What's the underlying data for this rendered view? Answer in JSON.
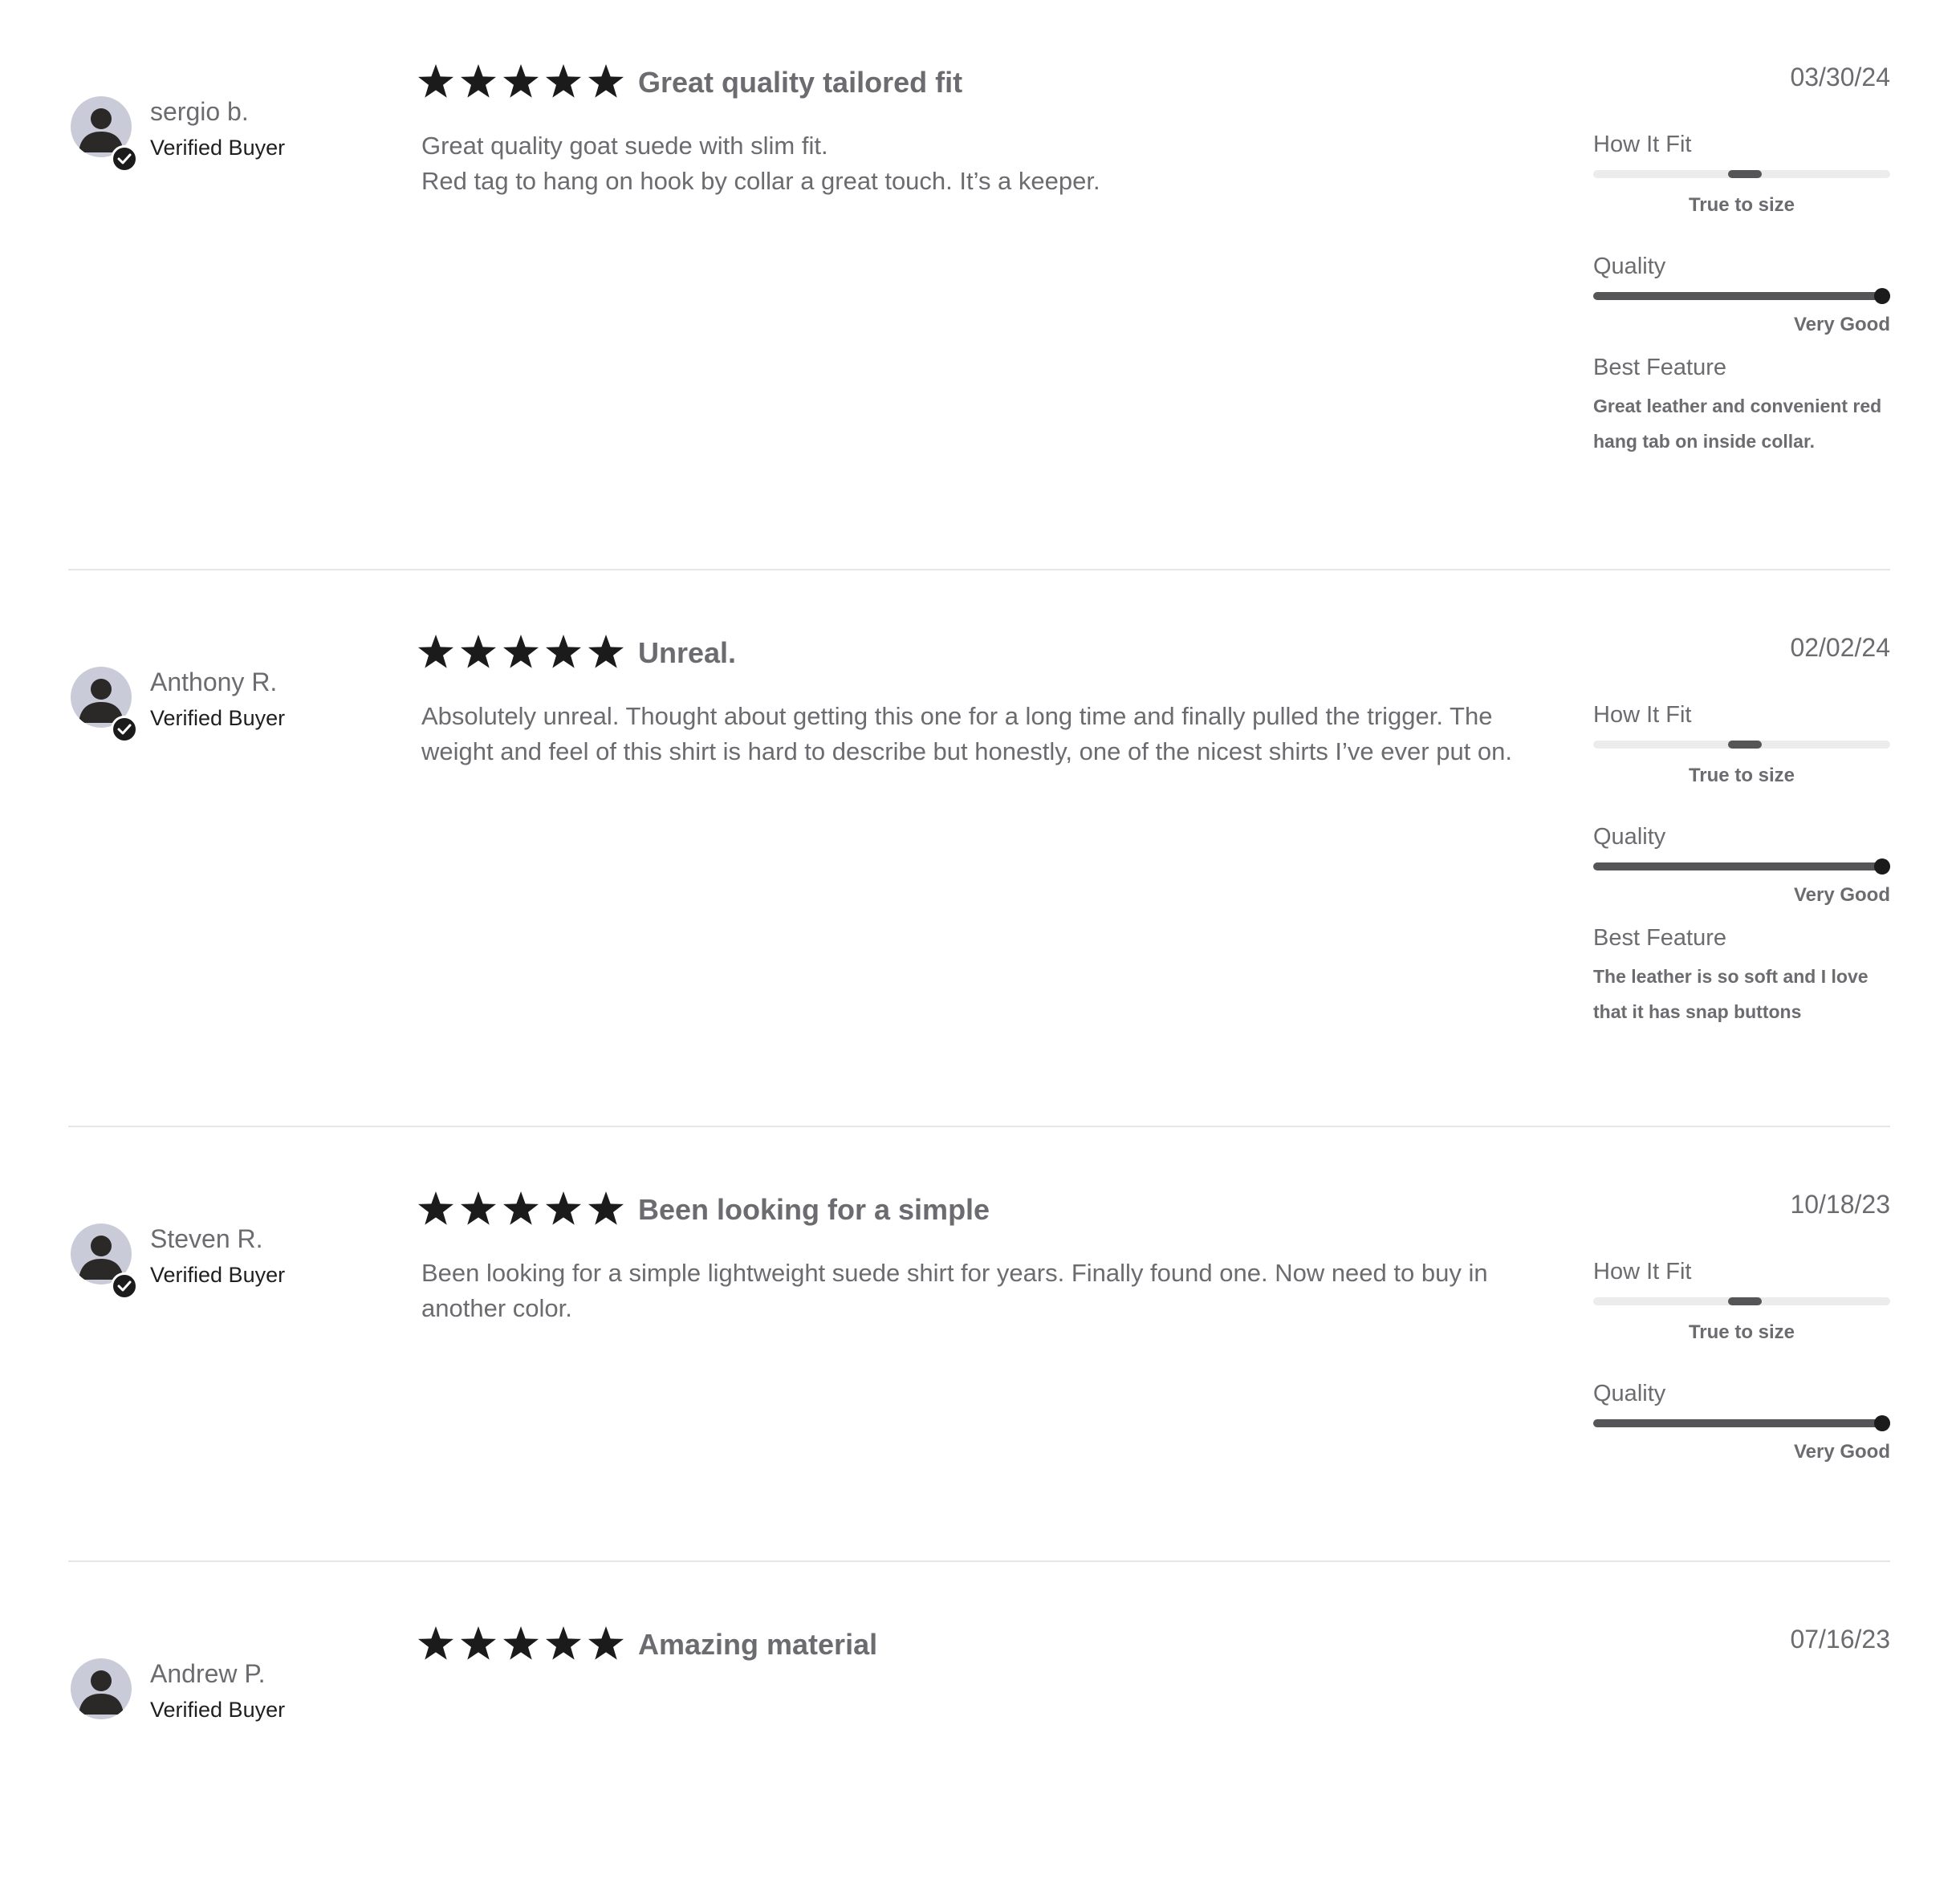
{
  "reviews": [
    {
      "name": "sergio b.",
      "verified": "Verified Buyer",
      "rating": 5,
      "title": "Great quality tailored fit",
      "body": [
        "Great quality goat suede with slim fit.",
        "Red tag to hang on hook by collar a great touch. It’s a keeper."
      ],
      "date": "03/30/24",
      "fit_label": "How It Fit",
      "fit_value": "True to size",
      "fit_position": 0.5,
      "quality_label": "Quality",
      "quality_value": "Very Good",
      "quality_level": 1.0,
      "feature_label": "Best Feature",
      "feature_value": "Great leather and convenient red hang tab on inside collar."
    },
    {
      "name": "Anthony R.",
      "verified": "Verified Buyer",
      "rating": 5,
      "title": "Unreal.",
      "body": [
        "Absolutely unreal. Thought about getting this one for a long time and finally pulled the trigger. The weight and feel of this shirt is hard to describe but honestly, one of the nicest shirts I’ve ever put on."
      ],
      "date": "02/02/24",
      "fit_label": "How It Fit",
      "fit_value": "True to size",
      "fit_position": 0.5,
      "quality_label": "Quality",
      "quality_value": "Very Good",
      "quality_level": 1.0,
      "feature_label": "Best Feature",
      "feature_value": "The leather is so soft and I love that it has snap buttons"
    },
    {
      "name": "Steven R.",
      "verified": "Verified Buyer",
      "rating": 5,
      "title": "Been looking for a simple",
      "body": [
        "Been looking for a simple lightweight suede shirt for years. Finally found one. Now need to buy in another color."
      ],
      "date": "10/18/23",
      "fit_label": "How It Fit",
      "fit_value": "True to size",
      "fit_position": 0.5,
      "quality_label": "Quality",
      "quality_value": "Very Good",
      "quality_level": 1.0
    },
    {
      "name": "Andrew P.",
      "verified": "Verified Buyer",
      "rating": 5,
      "title": "Amazing material",
      "date": "07/16/23"
    }
  ],
  "colors": {
    "star": "#1b1b1b",
    "text": "#6b6b70",
    "avatar_bg": "#c9ccd8",
    "track": "#ececec",
    "fill": "#555558"
  },
  "icons": {
    "star": "star-icon",
    "avatar": "user-avatar-icon",
    "verified": "checkmark-icon"
  }
}
